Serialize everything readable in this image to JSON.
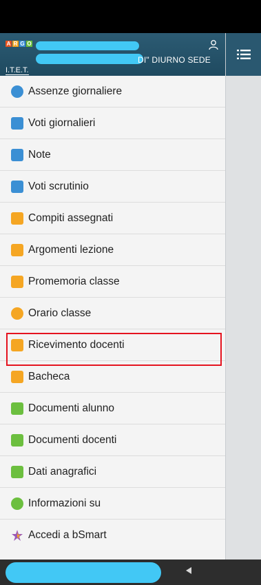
{
  "header": {
    "logo_letters": [
      "A",
      "R",
      "G",
      "O"
    ],
    "school_name": "DI\" DIURNO SEDE",
    "school_type": "I.T.E.T."
  },
  "menu": [
    {
      "label": "Assenze giornaliere",
      "icon": "absence-icon",
      "color": "#3b8fd4"
    },
    {
      "label": "Voti giornalieri",
      "icon": "daily-grades-icon",
      "color": "#3b8fd4"
    },
    {
      "label": "Note",
      "icon": "notes-icon",
      "color": "#3b8fd4"
    },
    {
      "label": "Voti scrutinio",
      "icon": "final-grades-icon",
      "color": "#3b8fd4"
    },
    {
      "label": "Compiti assegnati",
      "icon": "homework-icon",
      "color": "#f5a623"
    },
    {
      "label": "Argomenti lezione",
      "icon": "lesson-topics-icon",
      "color": "#f5a623"
    },
    {
      "label": "Promemoria classe",
      "icon": "reminder-icon",
      "color": "#f5a623"
    },
    {
      "label": "Orario classe",
      "icon": "timetable-icon",
      "color": "#f5a623"
    },
    {
      "label": "Ricevimento docenti",
      "icon": "teacher-meeting-icon",
      "color": "#f5a623"
    },
    {
      "label": "Bacheca",
      "icon": "bulletin-board-icon",
      "color": "#f5a623"
    },
    {
      "label": "Documenti alunno",
      "icon": "student-documents-icon",
      "color": "#6cbf3f"
    },
    {
      "label": "Documenti docenti",
      "icon": "teacher-documents-icon",
      "color": "#6cbf3f"
    },
    {
      "label": "Dati anagrafici",
      "icon": "personal-data-icon",
      "color": "#6cbf3f"
    },
    {
      "label": "Informazioni su",
      "icon": "info-icon",
      "color": "#6cbf3f"
    },
    {
      "label": "Accedi a bSmart",
      "icon": "bsmart-icon",
      "color": "#9b59b6"
    }
  ],
  "highlighted_item": "Ricevimento docenti",
  "colors": {
    "header_bg": "#2a5870",
    "highlight_border": "#e5131f",
    "redaction": "#42c8f5"
  }
}
